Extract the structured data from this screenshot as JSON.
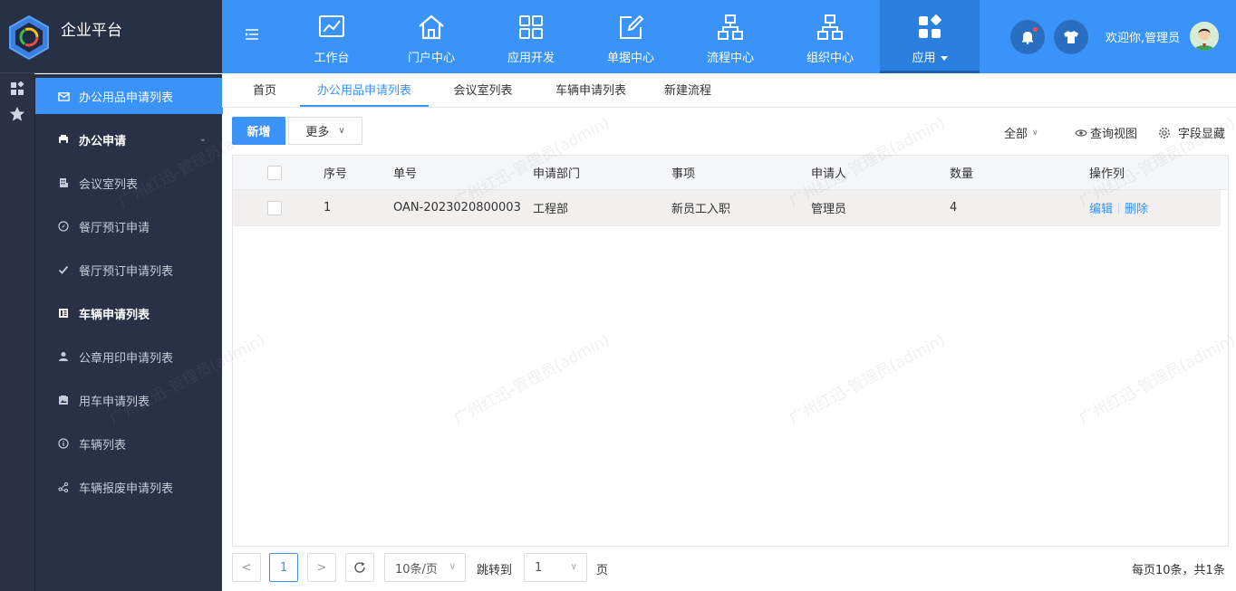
{
  "brand": {
    "name": "企业平台"
  },
  "topnav": {
    "items": [
      {
        "label": "工作台",
        "icon": "chart-line-icon"
      },
      {
        "label": "门户中心",
        "icon": "home-icon"
      },
      {
        "label": "应用开发",
        "icon": "grid-icon"
      },
      {
        "label": "单据中心",
        "icon": "edit-icon"
      },
      {
        "label": "流程中心",
        "icon": "flow-icon"
      },
      {
        "label": "组织中心",
        "icon": "org-icon"
      },
      {
        "label": "应用",
        "icon": "apps-icon",
        "active": true
      }
    ],
    "welcome": "欢迎你,管理员"
  },
  "sidebar": {
    "items": [
      {
        "label": "办公用品申请列表",
        "icon": "inbox-icon",
        "active": true
      },
      {
        "label": "办公申请",
        "icon": "printer-icon",
        "group": true
      },
      {
        "label": "会议室列表",
        "icon": "building-icon"
      },
      {
        "label": "餐厅预订申请",
        "icon": "compass-icon"
      },
      {
        "label": "餐厅预订申请列表",
        "icon": "check-icon"
      },
      {
        "label": "车辆申请列表",
        "icon": "list-icon",
        "bold": true
      },
      {
        "label": "公章用印申请列表",
        "icon": "user-icon"
      },
      {
        "label": "用车申请列表",
        "icon": "image-icon"
      },
      {
        "label": "车辆列表",
        "icon": "info-icon"
      },
      {
        "label": "车辆报废申请列表",
        "icon": "share-icon"
      }
    ]
  },
  "tabs": [
    {
      "label": "首页"
    },
    {
      "label": "办公用品申请列表",
      "active": true
    },
    {
      "label": "会议室列表"
    },
    {
      "label": "车辆申请列表"
    },
    {
      "label": "新建流程"
    }
  ],
  "toolbar": {
    "add_label": "新增",
    "more_label": "更多",
    "filter_label": "全部",
    "view_label": "查询视图",
    "field_label": "字段显藏"
  },
  "table": {
    "headers": [
      "序号",
      "单号",
      "申请部门",
      "事项",
      "申请人",
      "数量",
      "操作列"
    ],
    "rows": [
      {
        "index": "1",
        "no": "OAN-2023020800003",
        "dept": "工程部",
        "item": "新员工入职",
        "applicant": "管理员",
        "qty": "4",
        "edit": "编辑",
        "delete": "删除"
      }
    ]
  },
  "pager": {
    "current": "1",
    "page_size": "10条/页",
    "jump_label": "跳转到",
    "jump_value": "1",
    "page_unit": "页",
    "summary": "每页10条，共1条"
  },
  "watermark": "广州红迅-管理员(admin)",
  "colors": {
    "primary": "#3a93f8",
    "sidebar": "#283146"
  }
}
